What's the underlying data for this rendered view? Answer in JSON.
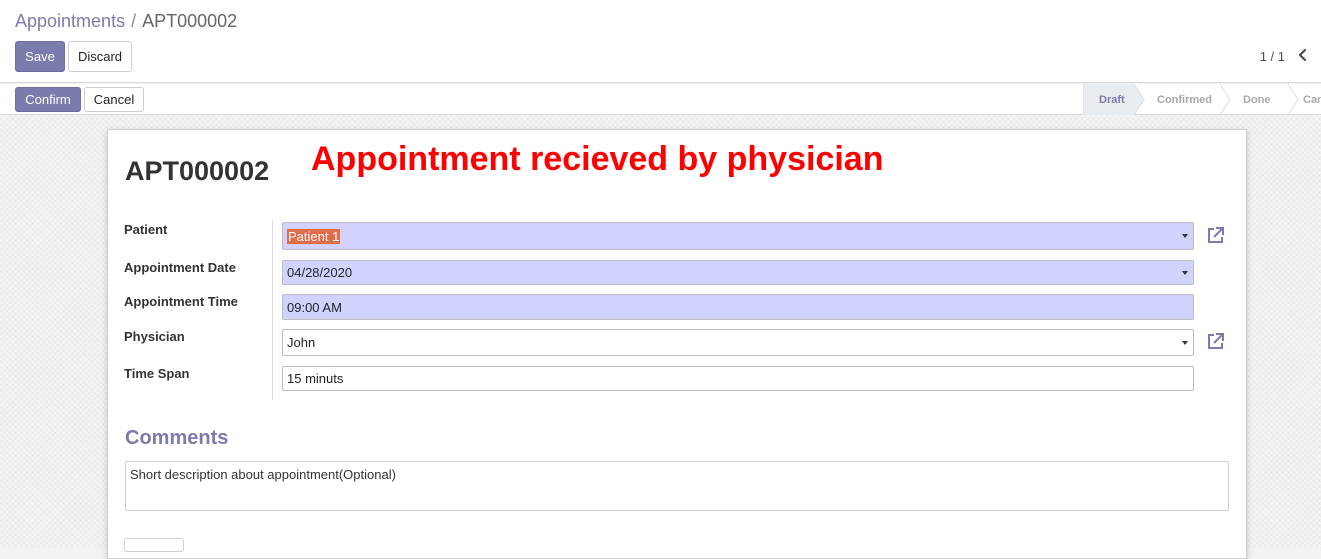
{
  "breadcrumb": {
    "parent": "Appointments",
    "separator": "/",
    "current": "APT000002"
  },
  "toolbar": {
    "save_label": "Save",
    "discard_label": "Discard"
  },
  "pager": {
    "value": "1 / 1",
    "prev_icon": "chevron-left-icon"
  },
  "statusbar": {
    "confirm_label": "Confirm",
    "cancel_label": "Cancel",
    "stages": [
      "Draft",
      "Confirmed",
      "Done",
      "Canceled"
    ],
    "active_stage": "Draft"
  },
  "form": {
    "record_name": "APT000002",
    "annotation": "Appointment recieved by physician",
    "fields": {
      "patient": {
        "label": "Patient",
        "value": "Patient 1"
      },
      "appointment_date": {
        "label": "Appointment Date",
        "value": "04/28/2020"
      },
      "appointment_time": {
        "label": "Appointment Time",
        "value": "09:00 AM"
      },
      "physician": {
        "label": "Physician",
        "value": "John"
      },
      "time_span": {
        "label": "Time Span",
        "value": "15 minuts"
      }
    },
    "comments": {
      "title": "Comments",
      "value": "Short description about appointment(Optional)"
    }
  },
  "icons": {
    "external_link": "external-link-icon",
    "dropdown": "caret-down-icon"
  },
  "colors": {
    "accent": "#7c7bad",
    "required_field": "#d2d2ff",
    "annotation": "#ff0000",
    "selection": "#e06c4a"
  }
}
